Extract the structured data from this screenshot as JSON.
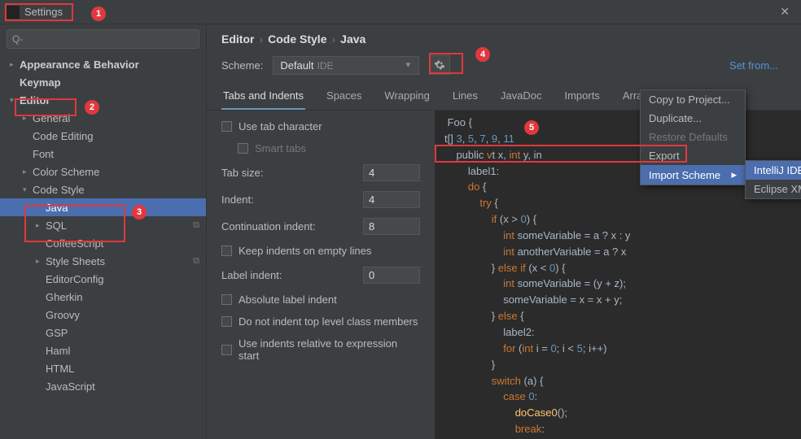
{
  "title": "Settings",
  "search_placeholder": "Q-",
  "tree": {
    "appearance": "Appearance & Behavior",
    "keymap": "Keymap",
    "editor": "Editor",
    "general": "General",
    "code_editing": "Code Editing",
    "font": "Font",
    "color_scheme": "Color Scheme",
    "code_style": "Code Style",
    "java": "Java",
    "sql": "SQL",
    "coffee": "CoffeeScript",
    "style_sheets": "Style Sheets",
    "editorconfig": "EditorConfig",
    "gherkin": "Gherkin",
    "groovy": "Groovy",
    "gsp": "GSP",
    "haml": "Haml",
    "html": "HTML",
    "javascript": "JavaScript"
  },
  "breadcrumb": {
    "a": "Editor",
    "b": "Code Style",
    "c": "Java"
  },
  "scheme": {
    "label": "Scheme:",
    "name": "Default",
    "suffix": "IDE",
    "set_from": "Set from..."
  },
  "tabs": {
    "t0": "Tabs and Indents",
    "t1": "Spaces",
    "t2": "Wrapping",
    "t3": "Lines",
    "t4": "JavaDoc",
    "t5": "Imports",
    "t6": "Arrangement"
  },
  "opts": {
    "use_tab": "Use tab character",
    "smart_tabs": "Smart tabs",
    "tab_size": "Tab size:",
    "tab_size_v": "4",
    "indent": "Indent:",
    "indent_v": "4",
    "cont": "Continuation indent:",
    "cont_v": "8",
    "keep_indents": "Keep indents on empty lines",
    "label_indent": "Label indent:",
    "label_indent_v": "0",
    "abs_label": "Absolute label indent",
    "no_top": "Do not indent top level class members",
    "rel_expr": "Use indents relative to expression start"
  },
  "gear": {
    "copy": "Copy to Project...",
    "dup": "Duplicate...",
    "restore": "Restore Defaults",
    "export": "Export",
    "import": "Import Scheme"
  },
  "submenu": {
    "intellij": "IntelliJ IDEA code style XML",
    "eclipse": "Eclipse XML Profile"
  },
  "code": {
    "l1": " Foo {",
    "l2_a": "t[] ",
    "l2_b": "3",
    "l2_c": ", ",
    "l2_d": "5",
    "l2_e": ", ",
    "l2_f": "7",
    "l2_g": ", ",
    "l2_h": "9",
    "l2_i": ", ",
    "l2_j": "11",
    "l3_a": "    public ",
    "l3_b": "v",
    "l3_c": "t x, ",
    "l3_d": "int",
    "l3_e": " y, in",
    "l4": "        label1:",
    "l5_a": "        do",
    "l5_b": " {",
    "l6_a": "            try",
    "l6_b": " {",
    "l7_a": "                if",
    "l7_b": " (x > ",
    "l7_c": "0",
    "l7_d": ") {",
    "l8_a": "                    int",
    "l8_b": " someVariable = a ? x : y",
    "l9_a": "                    int",
    "l9_b": " anotherVariable = a ? x",
    "l10_a": "                } ",
    "l10_b": "else if",
    "l10_c": " (x < ",
    "l10_d": "0",
    "l10_e": ") {",
    "l11_a": "                    int",
    "l11_b": " someVariable = (y + z);",
    "l12": "                    someVariable = x = x + y;",
    "l13_a": "                } ",
    "l13_b": "else",
    "l13_c": " {",
    "l14": "                    label2:",
    "l15_a": "                    for",
    "l15_b": " (",
    "l15_c": "int",
    "l15_d": " i = ",
    "l15_e": "0",
    "l15_f": "; i < ",
    "l15_g": "5",
    "l15_h": "; i++) ",
    "l16": "                }",
    "l17_a": "                switch",
    "l17_b": " (a) {",
    "l18_a": "                    case ",
    "l18_b": "0",
    "l18_c": ":",
    "l19_a": "                        ",
    "l19_b": "doCase0",
    "l19_c": "();",
    "l20_a": "                        ",
    "l20_b": "break",
    "l20_c": ":"
  }
}
